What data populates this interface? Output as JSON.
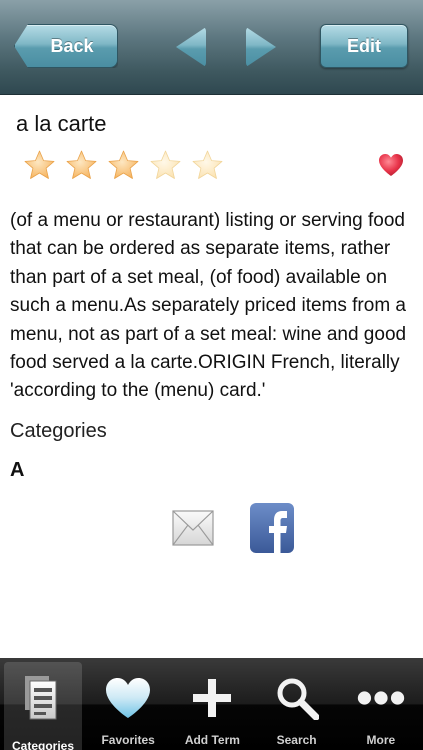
{
  "nav": {
    "back_label": "Back",
    "edit_label": "Edit"
  },
  "entry": {
    "term": "a la carte",
    "rating": 3,
    "rating_max": 5,
    "favorite": true,
    "definition": "(of a menu or restaurant) listing or serving food that can be ordered as separate items, rather than part of a set meal, (of food) available on such a menu.As separately priced items from a menu, not as part of a set meal: wine and good food served a la carte.ORIGIN French, literally 'according to the (menu) card.'",
    "categories_label": "Categories",
    "category": "A"
  },
  "share": {
    "email_icon": "envelope-icon",
    "facebook_icon": "facebook-icon"
  },
  "tabbar": {
    "selected": "Categories",
    "items": [
      {
        "label": "Categories",
        "icon": "document-stack-icon"
      },
      {
        "label": "Favorites",
        "icon": "heart-icon"
      },
      {
        "label": "Add Term",
        "icon": "plus-icon"
      },
      {
        "label": "Search",
        "icon": "magnifier-icon"
      },
      {
        "label": "More",
        "icon": "ellipsis-icon"
      }
    ]
  },
  "colors": {
    "nav_button": "#5a9cae",
    "star_filled": "#f6b35d",
    "star_empty": "#fbe2b0",
    "heart": "#e8344a",
    "facebook": "#3b5998"
  }
}
